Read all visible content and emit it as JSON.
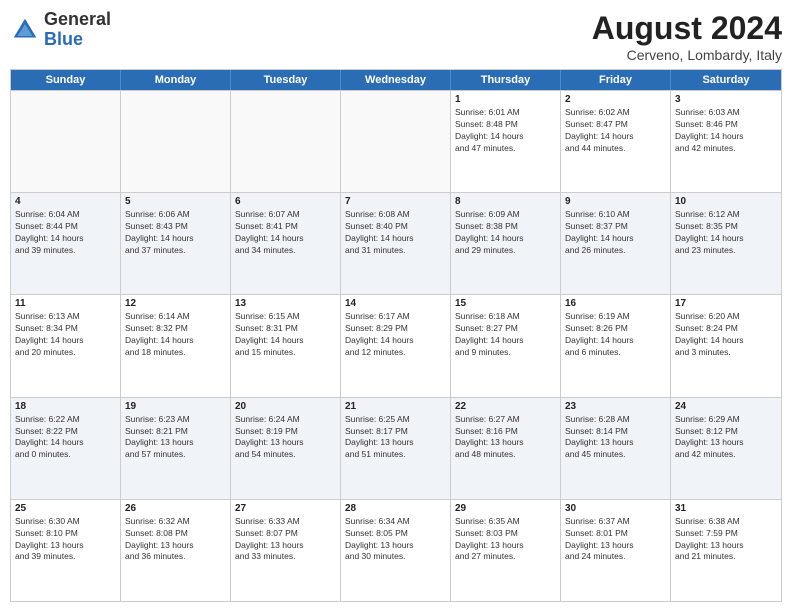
{
  "header": {
    "logo": {
      "line1": "General",
      "line2": "Blue"
    },
    "title": "August 2024",
    "location": "Cerveno, Lombardy, Italy"
  },
  "days_of_week": [
    "Sunday",
    "Monday",
    "Tuesday",
    "Wednesday",
    "Thursday",
    "Friday",
    "Saturday"
  ],
  "rows": [
    {
      "alt": false,
      "cells": [
        {
          "empty": true,
          "day": "",
          "info": ""
        },
        {
          "empty": true,
          "day": "",
          "info": ""
        },
        {
          "empty": true,
          "day": "",
          "info": ""
        },
        {
          "empty": true,
          "day": "",
          "info": ""
        },
        {
          "empty": false,
          "day": "1",
          "info": "Sunrise: 6:01 AM\nSunset: 8:48 PM\nDaylight: 14 hours\nand 47 minutes."
        },
        {
          "empty": false,
          "day": "2",
          "info": "Sunrise: 6:02 AM\nSunset: 8:47 PM\nDaylight: 14 hours\nand 44 minutes."
        },
        {
          "empty": false,
          "day": "3",
          "info": "Sunrise: 6:03 AM\nSunset: 8:46 PM\nDaylight: 14 hours\nand 42 minutes."
        }
      ]
    },
    {
      "alt": true,
      "cells": [
        {
          "empty": false,
          "day": "4",
          "info": "Sunrise: 6:04 AM\nSunset: 8:44 PM\nDaylight: 14 hours\nand 39 minutes."
        },
        {
          "empty": false,
          "day": "5",
          "info": "Sunrise: 6:06 AM\nSunset: 8:43 PM\nDaylight: 14 hours\nand 37 minutes."
        },
        {
          "empty": false,
          "day": "6",
          "info": "Sunrise: 6:07 AM\nSunset: 8:41 PM\nDaylight: 14 hours\nand 34 minutes."
        },
        {
          "empty": false,
          "day": "7",
          "info": "Sunrise: 6:08 AM\nSunset: 8:40 PM\nDaylight: 14 hours\nand 31 minutes."
        },
        {
          "empty": false,
          "day": "8",
          "info": "Sunrise: 6:09 AM\nSunset: 8:38 PM\nDaylight: 14 hours\nand 29 minutes."
        },
        {
          "empty": false,
          "day": "9",
          "info": "Sunrise: 6:10 AM\nSunset: 8:37 PM\nDaylight: 14 hours\nand 26 minutes."
        },
        {
          "empty": false,
          "day": "10",
          "info": "Sunrise: 6:12 AM\nSunset: 8:35 PM\nDaylight: 14 hours\nand 23 minutes."
        }
      ]
    },
    {
      "alt": false,
      "cells": [
        {
          "empty": false,
          "day": "11",
          "info": "Sunrise: 6:13 AM\nSunset: 8:34 PM\nDaylight: 14 hours\nand 20 minutes."
        },
        {
          "empty": false,
          "day": "12",
          "info": "Sunrise: 6:14 AM\nSunset: 8:32 PM\nDaylight: 14 hours\nand 18 minutes."
        },
        {
          "empty": false,
          "day": "13",
          "info": "Sunrise: 6:15 AM\nSunset: 8:31 PM\nDaylight: 14 hours\nand 15 minutes."
        },
        {
          "empty": false,
          "day": "14",
          "info": "Sunrise: 6:17 AM\nSunset: 8:29 PM\nDaylight: 14 hours\nand 12 minutes."
        },
        {
          "empty": false,
          "day": "15",
          "info": "Sunrise: 6:18 AM\nSunset: 8:27 PM\nDaylight: 14 hours\nand 9 minutes."
        },
        {
          "empty": false,
          "day": "16",
          "info": "Sunrise: 6:19 AM\nSunset: 8:26 PM\nDaylight: 14 hours\nand 6 minutes."
        },
        {
          "empty": false,
          "day": "17",
          "info": "Sunrise: 6:20 AM\nSunset: 8:24 PM\nDaylight: 14 hours\nand 3 minutes."
        }
      ]
    },
    {
      "alt": true,
      "cells": [
        {
          "empty": false,
          "day": "18",
          "info": "Sunrise: 6:22 AM\nSunset: 8:22 PM\nDaylight: 14 hours\nand 0 minutes."
        },
        {
          "empty": false,
          "day": "19",
          "info": "Sunrise: 6:23 AM\nSunset: 8:21 PM\nDaylight: 13 hours\nand 57 minutes."
        },
        {
          "empty": false,
          "day": "20",
          "info": "Sunrise: 6:24 AM\nSunset: 8:19 PM\nDaylight: 13 hours\nand 54 minutes."
        },
        {
          "empty": false,
          "day": "21",
          "info": "Sunrise: 6:25 AM\nSunset: 8:17 PM\nDaylight: 13 hours\nand 51 minutes."
        },
        {
          "empty": false,
          "day": "22",
          "info": "Sunrise: 6:27 AM\nSunset: 8:16 PM\nDaylight: 13 hours\nand 48 minutes."
        },
        {
          "empty": false,
          "day": "23",
          "info": "Sunrise: 6:28 AM\nSunset: 8:14 PM\nDaylight: 13 hours\nand 45 minutes."
        },
        {
          "empty": false,
          "day": "24",
          "info": "Sunrise: 6:29 AM\nSunset: 8:12 PM\nDaylight: 13 hours\nand 42 minutes."
        }
      ]
    },
    {
      "alt": false,
      "cells": [
        {
          "empty": false,
          "day": "25",
          "info": "Sunrise: 6:30 AM\nSunset: 8:10 PM\nDaylight: 13 hours\nand 39 minutes."
        },
        {
          "empty": false,
          "day": "26",
          "info": "Sunrise: 6:32 AM\nSunset: 8:08 PM\nDaylight: 13 hours\nand 36 minutes."
        },
        {
          "empty": false,
          "day": "27",
          "info": "Sunrise: 6:33 AM\nSunset: 8:07 PM\nDaylight: 13 hours\nand 33 minutes."
        },
        {
          "empty": false,
          "day": "28",
          "info": "Sunrise: 6:34 AM\nSunset: 8:05 PM\nDaylight: 13 hours\nand 30 minutes."
        },
        {
          "empty": false,
          "day": "29",
          "info": "Sunrise: 6:35 AM\nSunset: 8:03 PM\nDaylight: 13 hours\nand 27 minutes."
        },
        {
          "empty": false,
          "day": "30",
          "info": "Sunrise: 6:37 AM\nSunset: 8:01 PM\nDaylight: 13 hours\nand 24 minutes."
        },
        {
          "empty": false,
          "day": "31",
          "info": "Sunrise: 6:38 AM\nSunset: 7:59 PM\nDaylight: 13 hours\nand 21 minutes."
        }
      ]
    }
  ]
}
